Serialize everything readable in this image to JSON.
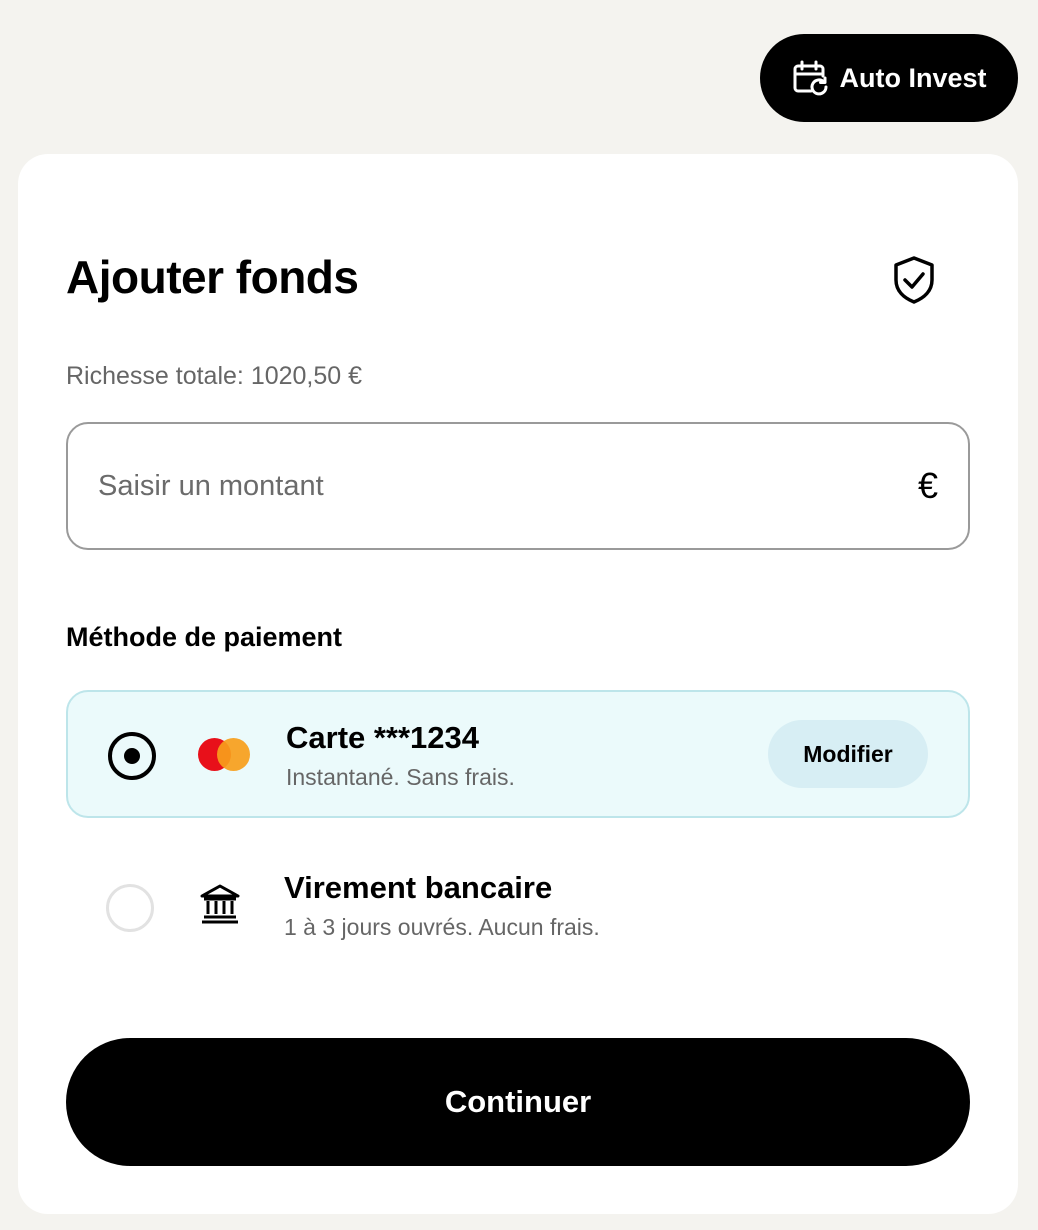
{
  "header": {
    "auto_invest_label": "Auto Invest",
    "auto_invest_icon": "calendar-refresh-icon"
  },
  "panel": {
    "title": "Ajouter fonds",
    "security_icon": "shield-check-icon",
    "total_wealth": "Richesse totale: 1020,50 €"
  },
  "amount_input": {
    "value": "",
    "placeholder": "Saisir un montant",
    "currency_symbol": "€"
  },
  "payment": {
    "section_label": "Méthode de paiement",
    "methods": [
      {
        "title": "Carte ***1234",
        "subtitle": "Instantané. Sans frais.",
        "icon": "mastercard-icon",
        "selected": true,
        "action_label": "Modifier"
      },
      {
        "title": "Virement bancaire",
        "subtitle": "1 à 3 jours ouvrés. Aucun frais.",
        "icon": "bank-icon",
        "selected": false
      }
    ]
  },
  "footer": {
    "continue_label": "Continuer"
  },
  "colors": {
    "page_background": "#f4f3ef",
    "selected_option_background": "#ebfafb",
    "selected_option_border": "#bde5ea",
    "modify_button_background": "#d7eef4",
    "primary_button": "#000000",
    "mastercard_red": "#e8101a",
    "mastercard_orange": "#f79e1b"
  }
}
